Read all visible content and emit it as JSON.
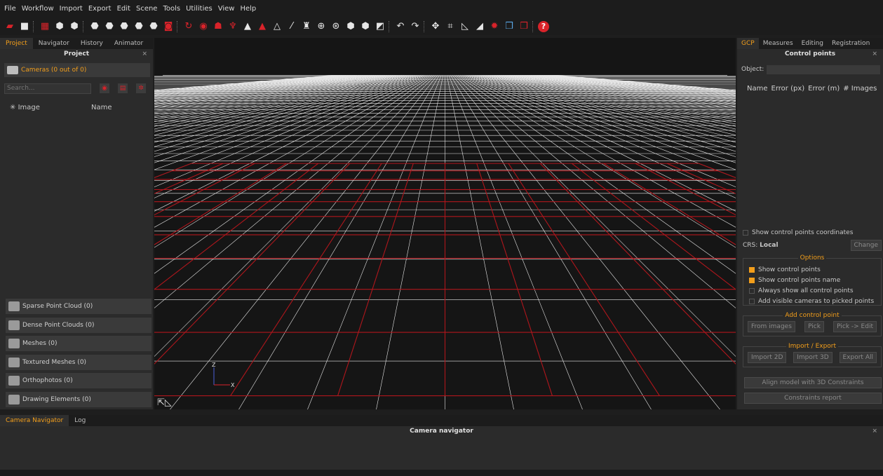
{
  "menu": [
    "File",
    "Workflow",
    "Import",
    "Export",
    "Edit",
    "Scene",
    "Tools",
    "Utilities",
    "View",
    "Help"
  ],
  "toolbar_icons": [
    "new-project-icon",
    "save-icon",
    "sep",
    "images-icon",
    "sparse-cloud-icon",
    "dense-cloud-icon",
    "sep",
    "mesh-icon",
    "textured-mesh-icon",
    "mesh-color-icon",
    "mesh-filter-icon",
    "mesh-simplify-icon",
    "photo-icon",
    "sep",
    "rotate-icon",
    "target-icon",
    "cluster-icon",
    "person-icon",
    "triangle-icon",
    "triangle-red-icon",
    "triangle-outline-icon",
    "brush-icon",
    "sculpt-icon",
    "sphere-wire-icon",
    "sphere-icon",
    "mesh-solid-icon",
    "mesh-solid2-icon",
    "export-icon",
    "sep",
    "undo-icon",
    "redo-icon",
    "sep",
    "gizmo-icon",
    "crop-icon",
    "cut-icon",
    "measure-icon",
    "settings-icon",
    "cube-icon",
    "cube-red-icon",
    "sep",
    "help-icon"
  ],
  "left": {
    "tabs": [
      "Project",
      "Navigator",
      "History",
      "Animator"
    ],
    "active_tab": "Project",
    "title": "Project",
    "cameras_label": "Cameras (0 out of 0)",
    "search_placeholder": "Search...",
    "col_image": "Image",
    "col_name": "Name",
    "entities": [
      "Sparse Point Cloud (0)",
      "Dense Point Clouds (0)",
      "Meshes (0)",
      "Textured Meshes (0)",
      "Orthophotos (0)",
      "Drawing Elements (0)"
    ]
  },
  "viewport": {
    "axis_z": "Z",
    "axis_x": "X",
    "grid_color": "#e8e8e8",
    "highlight_color": "#b0161c"
  },
  "right": {
    "tabs": [
      "GCP",
      "Measures",
      "Editing",
      "Registration"
    ],
    "active_tab": "GCP",
    "title": "Control points",
    "object_label": "Object:",
    "columns": [
      "Name",
      "Error (px)",
      "Error (m)",
      "# Images"
    ],
    "show_coords_label": "Show control points coordinates",
    "crs_label": "CRS:",
    "crs_value": "Local",
    "change_button": "Change",
    "options_title": "Options",
    "options": [
      {
        "label": "Show control points",
        "checked": true
      },
      {
        "label": "Show control points name",
        "checked": true
      },
      {
        "label": "Always show all control points",
        "checked": false
      },
      {
        "label": "Add visible cameras to picked points",
        "checked": false
      }
    ],
    "add_title": "Add control point",
    "add_buttons": [
      "From images",
      "Pick",
      "Pick -> Edit"
    ],
    "io_title": "Import / Export",
    "io_buttons": [
      "Import 2D",
      "Import 3D",
      "Export All"
    ],
    "align_button": "Align model with 3D Constraints",
    "report_button": "Constraints report"
  },
  "bottom": {
    "tabs": [
      "Camera Navigator",
      "Log"
    ],
    "active_tab": "Camera Navigator",
    "title": "Camera navigator"
  },
  "colors": {
    "accent": "#f29e1b",
    "brand_red": "#d9232a"
  }
}
